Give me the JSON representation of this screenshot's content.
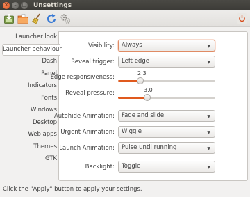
{
  "window": {
    "title": "Unsettings"
  },
  "toolbar": {
    "icons": [
      "import-icon",
      "export-icon",
      "broom-icon",
      "refresh-icon",
      "gears-icon",
      "power-icon"
    ]
  },
  "sidebar": {
    "items": [
      {
        "label": "Launcher look"
      },
      {
        "label": "Launcher behaviour",
        "selected": true
      },
      {
        "label": "Dash"
      },
      {
        "label": "Panel"
      },
      {
        "label": "Indicators"
      },
      {
        "label": "Fonts"
      },
      {
        "label": "Windows"
      },
      {
        "label": "Desktop"
      },
      {
        "label": "Web apps"
      },
      {
        "label": "Themes"
      },
      {
        "label": "GTK"
      }
    ]
  },
  "settings": {
    "visibility": {
      "label": "Visibility:",
      "value": "Always"
    },
    "reveal_trigger": {
      "label": "Reveal trigger:",
      "value": "Left edge"
    },
    "edge_responsiveness": {
      "label": "Edge responsiveness:",
      "value": "2.3",
      "fraction": 0.23
    },
    "reveal_pressure": {
      "label": "Reveal pressure:",
      "value": "3.0",
      "fraction": 0.3
    },
    "autohide_animation": {
      "label": "Autohide Animation:",
      "value": "Fade and slide"
    },
    "urgent_animation": {
      "label": "Urgent Animation:",
      "value": "Wiggle"
    },
    "launch_animation": {
      "label": "Launch Animation:",
      "value": "Pulse until running"
    },
    "backlight": {
      "label": "Backlight:",
      "value": "Toggle"
    }
  },
  "statusbar": {
    "text": "Click the \"Apply\" button to apply your settings."
  },
  "colors": {
    "accent": "#e05a1e",
    "titlebar": "#3c3b37",
    "close_button": "#e0541f"
  }
}
